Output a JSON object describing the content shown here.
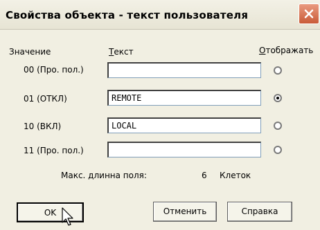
{
  "dialog": {
    "title": "Свойства объекта - текст пользователя"
  },
  "headers": {
    "value": "Значение",
    "text": "Текст",
    "display": "Отображать"
  },
  "rows": [
    {
      "label": "00 (Про. пол.)",
      "text": "",
      "selected": false
    },
    {
      "label": "01 (ОТКЛ)",
      "text": "REMOTE",
      "selected": true
    },
    {
      "label": "10 (ВКЛ)",
      "text": "LOCAL",
      "selected": false
    },
    {
      "label": "11 (Про. пол.)",
      "text": "",
      "selected": false
    }
  ],
  "max_length": {
    "label": "Макс. длинна поля:",
    "value": "6",
    "unit": "Клеток"
  },
  "buttons": {
    "ok": "OK",
    "cancel": "Отменить",
    "help": "Справка"
  }
}
